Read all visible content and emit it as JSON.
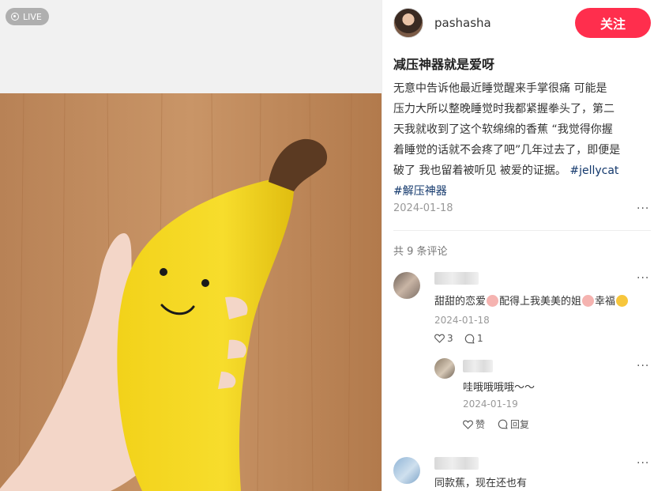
{
  "media": {
    "live_label": "LIVE"
  },
  "author": {
    "name": "pashasha",
    "follow_label": "关注"
  },
  "note": {
    "title": "减压神器就是爱呀",
    "body_lines": [
      "无意中告诉他最近睡觉醒来手掌很痛  可能是",
      "压力大所以整晚睡觉时我都紧握拳头了，第二",
      "天我就收到了这个软绵绵的香蕉 “我觉得你握",
      "着睡觉的话就不会疼了吧”几年过去了，即便是",
      "破了 我也留着被听见 被爱的证据。"
    ],
    "tag_jellycat": "#jellycat",
    "tag_relief": "#解压神器",
    "date": "2024-01-18",
    "more": "···"
  },
  "comments": {
    "count_label": "共 9 条评论",
    "items": [
      {
        "text_a": "甜甜的恋爱",
        "text_b": "配得上我美美的姐",
        "text_c": "幸福",
        "date": "2024-01-18",
        "likes": "3",
        "replies": "1",
        "more": "···"
      },
      {
        "text": "哇哦哦哦哦～～",
        "date": "2024-01-19",
        "like_label": "赞",
        "reply_label": "回复",
        "more": "···"
      },
      {
        "text": "同款蕉，现在还也有",
        "more": "···"
      }
    ]
  },
  "colors": {
    "follow": "#ff2e4d",
    "tag": "#13386c",
    "muted": "#999999"
  }
}
